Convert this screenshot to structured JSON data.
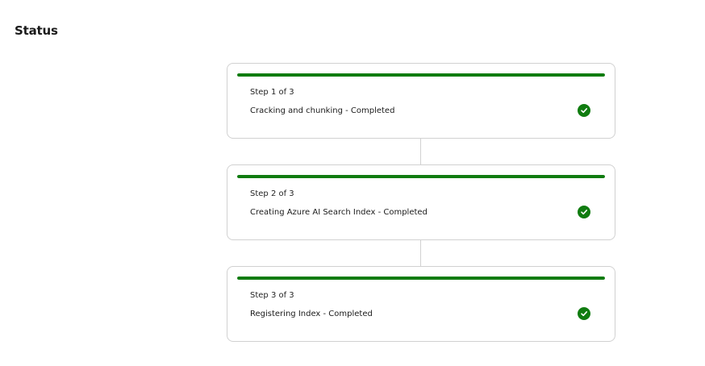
{
  "page": {
    "title": "Status"
  },
  "steps": [
    {
      "step_label": "Step 1 of 3",
      "status_text": "Cracking and chunking - Completed",
      "progress": 1.0,
      "state": "completed",
      "icon": "checkmark-circle-icon"
    },
    {
      "step_label": "Step 2 of 3",
      "status_text": "Creating Azure AI Search Index - Completed",
      "progress": 1.0,
      "state": "completed",
      "icon": "checkmark-circle-icon"
    },
    {
      "step_label": "Step 3 of 3",
      "status_text": "Registering Index - Completed",
      "progress": 1.0,
      "state": "completed",
      "icon": "checkmark-circle-icon"
    }
  ],
  "colors": {
    "success": "#107c10",
    "border": "#d1d1d1",
    "text": "#242424"
  }
}
